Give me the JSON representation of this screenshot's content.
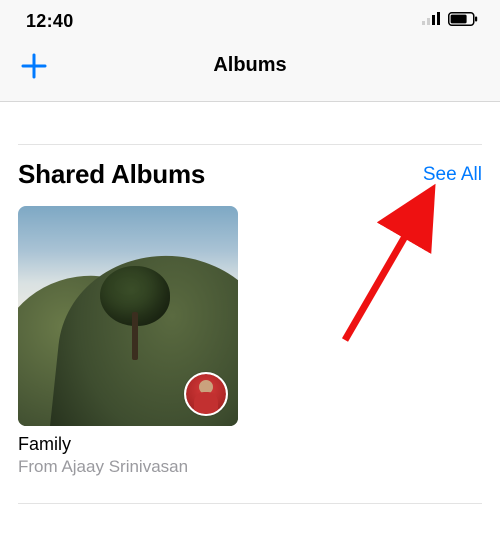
{
  "status": {
    "time": "12:40"
  },
  "nav": {
    "title": "Albums"
  },
  "section": {
    "title": "Shared Albums",
    "see_all": "See All"
  },
  "albums": [
    {
      "name": "Family",
      "subtitle": "From Ajaay Srinivasan"
    }
  ],
  "colors": {
    "accent": "#007aff"
  }
}
